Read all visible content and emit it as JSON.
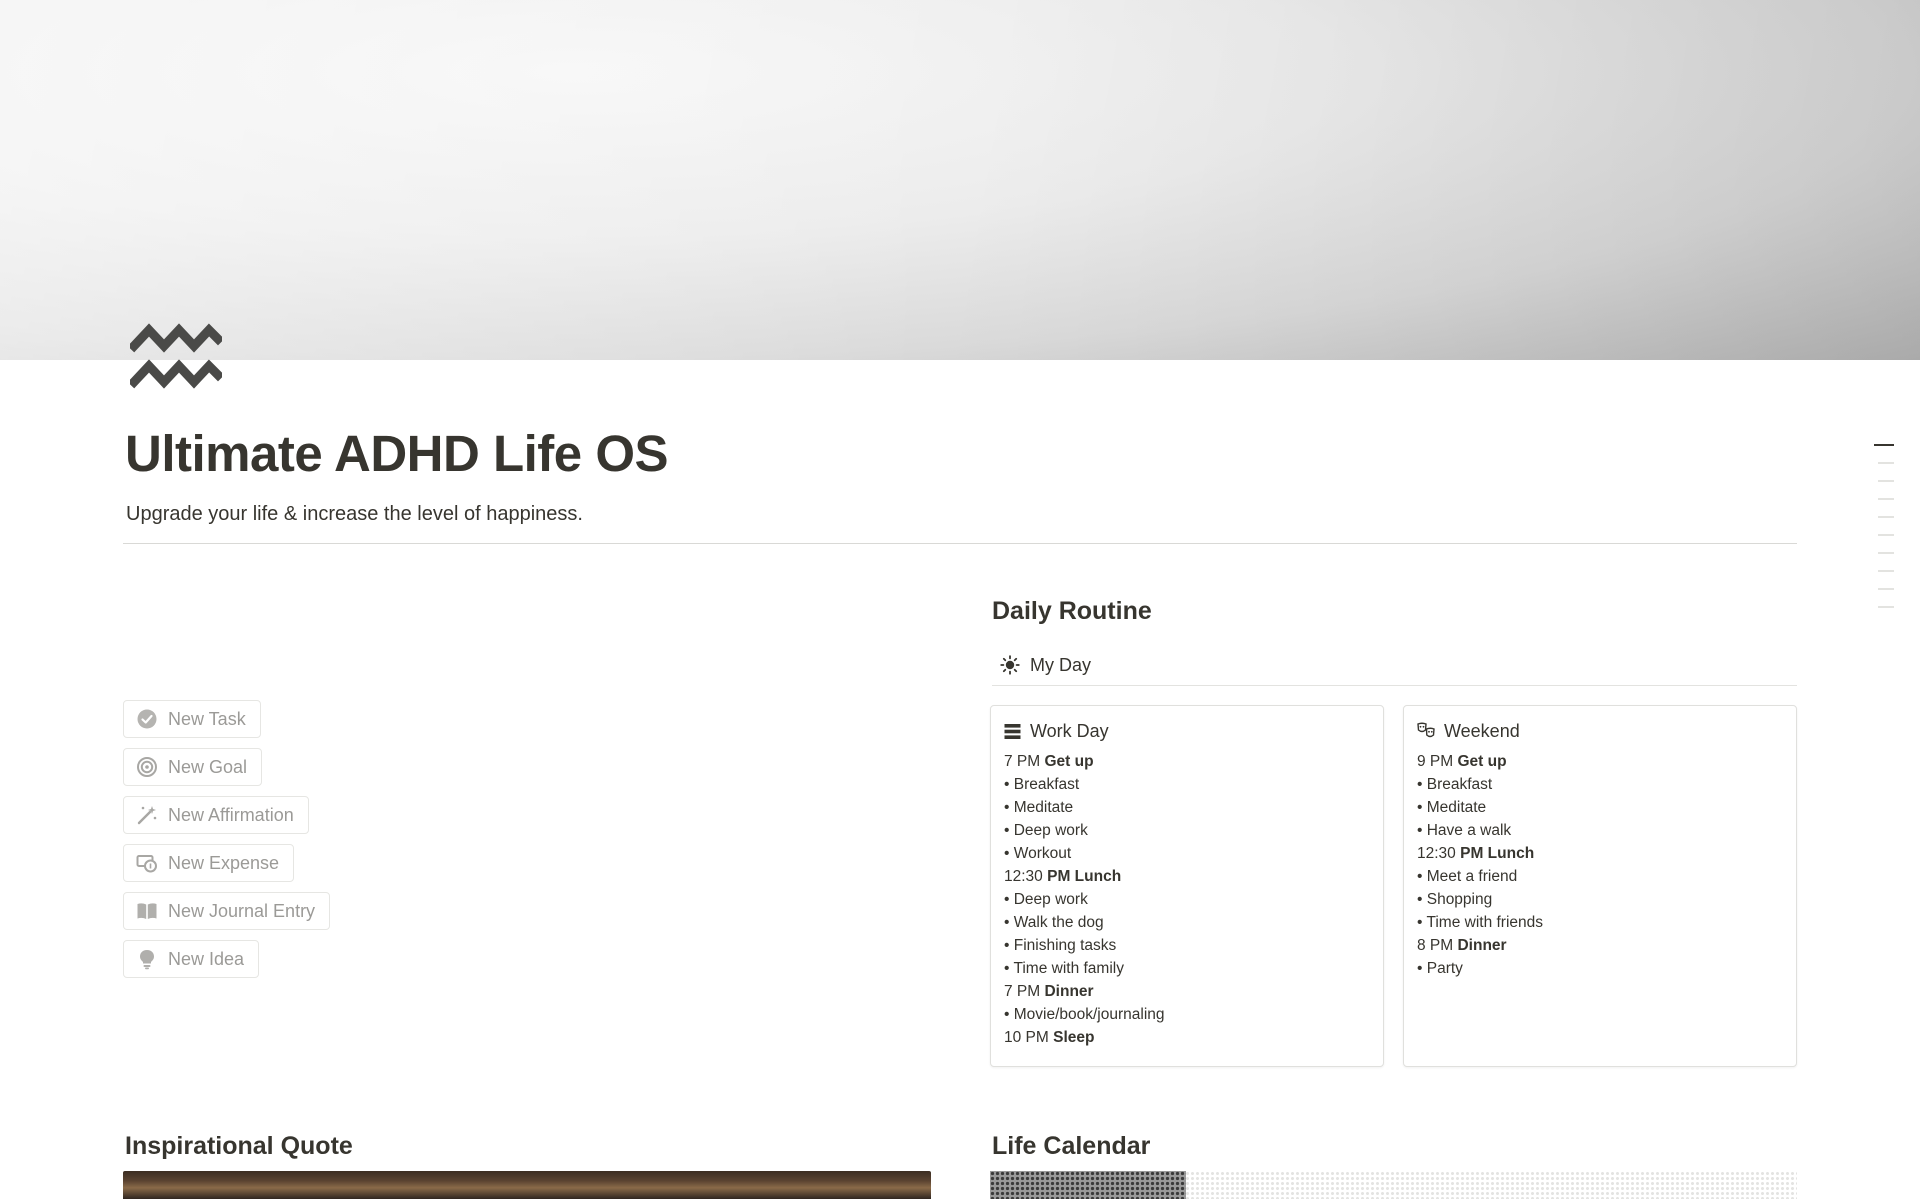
{
  "page": {
    "icon": "aquarius-zigzag-icon",
    "title": "Ultimate ADHD Life OS",
    "subtitle": "Upgrade your life & increase the level of happiness."
  },
  "buttons": [
    {
      "label": "New Task",
      "icon": "check-circle-icon"
    },
    {
      "label": "New Goal",
      "icon": "target-icon"
    },
    {
      "label": "New Affirmation",
      "icon": "magic-wand-icon"
    },
    {
      "label": "New Expense",
      "icon": "money-icon"
    },
    {
      "label": "New Journal Entry",
      "icon": "book-icon"
    },
    {
      "label": "New Idea",
      "icon": "lightbulb-icon"
    }
  ],
  "daily_routine": {
    "heading": "Daily Routine",
    "my_day": {
      "label": "My Day",
      "icon": "sun-icon"
    },
    "work_day": {
      "title": "Work Day",
      "icon": "stack-icon",
      "lines": [
        {
          "prefix": "7 PM ",
          "bold": "Get up"
        },
        {
          "prefix": "• Breakfast",
          "bold": ""
        },
        {
          "prefix": "• Meditate",
          "bold": ""
        },
        {
          "prefix": "• Deep work",
          "bold": ""
        },
        {
          "prefix": "• Workout",
          "bold": ""
        },
        {
          "prefix": "12:30 ",
          "bold": "PM Lunch"
        },
        {
          "prefix": "• Deep work",
          "bold": ""
        },
        {
          "prefix": "• Walk the dog",
          "bold": ""
        },
        {
          "prefix": "• Finishing tasks",
          "bold": ""
        },
        {
          "prefix": "• Time with family",
          "bold": ""
        },
        {
          "prefix": "7 PM ",
          "bold": "Dinner"
        },
        {
          "prefix": "• Movie/book/journaling",
          "bold": ""
        },
        {
          "prefix": "10 PM ",
          "bold": "Sleep"
        }
      ]
    },
    "weekend": {
      "title": "Weekend",
      "icon": "party-masks-icon",
      "lines": [
        {
          "prefix": "9 PM ",
          "bold": "Get up"
        },
        {
          "prefix": "• Breakfast",
          "bold": ""
        },
        {
          "prefix": "• Meditate",
          "bold": ""
        },
        {
          "prefix": "• Have a walk",
          "bold": ""
        },
        {
          "prefix": "12:30 ",
          "bold": "PM Lunch"
        },
        {
          "prefix": "• Meet a friend",
          "bold": ""
        },
        {
          "prefix": "• Shopping",
          "bold": ""
        },
        {
          "prefix": "• Time with friends",
          "bold": ""
        },
        {
          "prefix": "8 PM ",
          "bold": "Dinner"
        },
        {
          "prefix": "• Party",
          "bold": ""
        }
      ]
    }
  },
  "sections": {
    "quote_heading": "Inspirational Quote",
    "calendar_heading": "Life Calendar"
  },
  "toc": {
    "count": 10,
    "active_index": 0
  }
}
